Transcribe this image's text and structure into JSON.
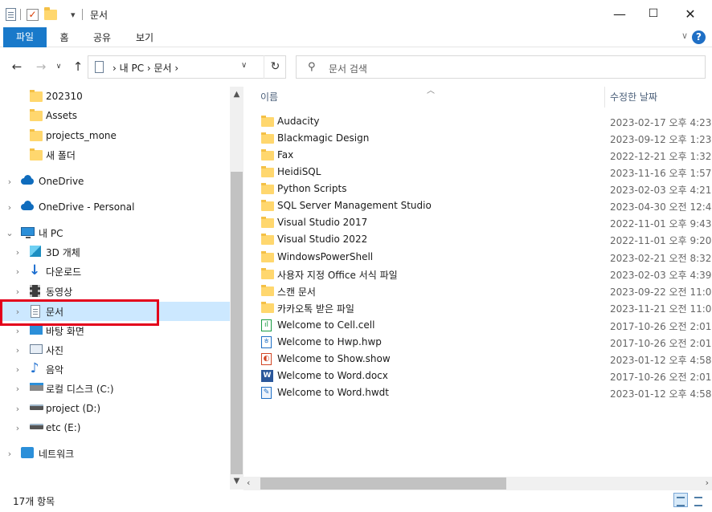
{
  "window": {
    "title": "문서",
    "minimize": "—",
    "maximize": "☐",
    "close": "✕",
    "qa_dropdown": "▾"
  },
  "ribbon": {
    "tabs": [
      "파일",
      "홈",
      "공유",
      "보기"
    ],
    "help": "?",
    "collapse": "∨"
  },
  "address": {
    "crumbs": "› 내 PC › 문서 ›",
    "dropdown": "∨",
    "refresh": "↻",
    "back": "←",
    "forward": "→",
    "recent": "∨",
    "up": "↑"
  },
  "search": {
    "placeholder": "문서 검색",
    "icon": "⚲"
  },
  "nav": {
    "items": [
      {
        "label": "202310",
        "icon": "folder-icon"
      },
      {
        "label": "Assets",
        "icon": "folder-icon"
      },
      {
        "label": "projects_mone",
        "icon": "folder-icon"
      },
      {
        "label": "새 폴더",
        "icon": "folder-icon"
      },
      {
        "label": "OneDrive",
        "icon": "cloud-icon"
      },
      {
        "label": "OneDrive - Personal",
        "icon": "cloud-icon"
      },
      {
        "label": "내 PC",
        "icon": "pc-icon"
      },
      {
        "label": "3D 개체",
        "icon": "cube-icon"
      },
      {
        "label": "다운로드",
        "icon": "download-icon"
      },
      {
        "label": "동영상",
        "icon": "video-icon"
      },
      {
        "label": "문서",
        "icon": "document-icon",
        "selected": true
      },
      {
        "label": "바탕 화면",
        "icon": "desktop-icon"
      },
      {
        "label": "사진",
        "icon": "pictures-icon"
      },
      {
        "label": "음악",
        "icon": "music-icon"
      },
      {
        "label": "로컬 디스크 (C:)",
        "icon": "drive-c-icon"
      },
      {
        "label": "project (D:)",
        "icon": "drive-icon"
      },
      {
        "label": "etc (E:)",
        "icon": "drive-icon"
      },
      {
        "label": "네트워크",
        "icon": "network-icon"
      }
    ]
  },
  "columns": {
    "name": "이름",
    "modified": "수정한 날짜"
  },
  "files": [
    {
      "name": "Audacity",
      "modified": "2023-02-17 오후 4:23",
      "type": "folder"
    },
    {
      "name": "Blackmagic Design",
      "modified": "2023-09-12 오후 1:23",
      "type": "folder"
    },
    {
      "name": "Fax",
      "modified": "2022-12-21 오후 1:32",
      "type": "folder"
    },
    {
      "name": "HeidiSQL",
      "modified": "2023-11-16 오후 1:57",
      "type": "folder"
    },
    {
      "name": "Python Scripts",
      "modified": "2023-02-03 오후 4:21",
      "type": "folder"
    },
    {
      "name": "SQL Server Management Studio",
      "modified": "2023-04-30 오전 12:4",
      "type": "folder"
    },
    {
      "name": "Visual Studio 2017",
      "modified": "2022-11-01 오후 9:43",
      "type": "folder"
    },
    {
      "name": "Visual Studio 2022",
      "modified": "2022-11-01 오후 9:20",
      "type": "folder"
    },
    {
      "name": "WindowsPowerShell",
      "modified": "2023-02-21 오전 8:32",
      "type": "folder"
    },
    {
      "name": "사용자 지정 Office 서식 파일",
      "modified": "2023-02-03 오후 4:39",
      "type": "folder"
    },
    {
      "name": "스캔 문서",
      "modified": "2023-09-22 오전 11:0",
      "type": "folder"
    },
    {
      "name": "카카오톡 받은 파일",
      "modified": "2023-11-21 오전 11:0",
      "type": "folder"
    },
    {
      "name": "Welcome to Cell.cell",
      "modified": "2017-10-26 오전 2:01",
      "type": "cell"
    },
    {
      "name": "Welcome to Hwp.hwp",
      "modified": "2017-10-26 오전 2:01",
      "type": "hwp"
    },
    {
      "name": "Welcome to Show.show",
      "modified": "2023-01-12 오후 4:58",
      "type": "show"
    },
    {
      "name": "Welcome to Word.docx",
      "modified": "2017-10-26 오전 2:01",
      "type": "word"
    },
    {
      "name": "Welcome to Word.hwdt",
      "modified": "2023-01-12 오후 4:58",
      "type": "hwdt"
    }
  ],
  "status": {
    "count": "17개 항목"
  },
  "colors": {
    "accent": "#1979ca",
    "selection": "#cce8ff",
    "highlight_box": "#e3001b"
  }
}
